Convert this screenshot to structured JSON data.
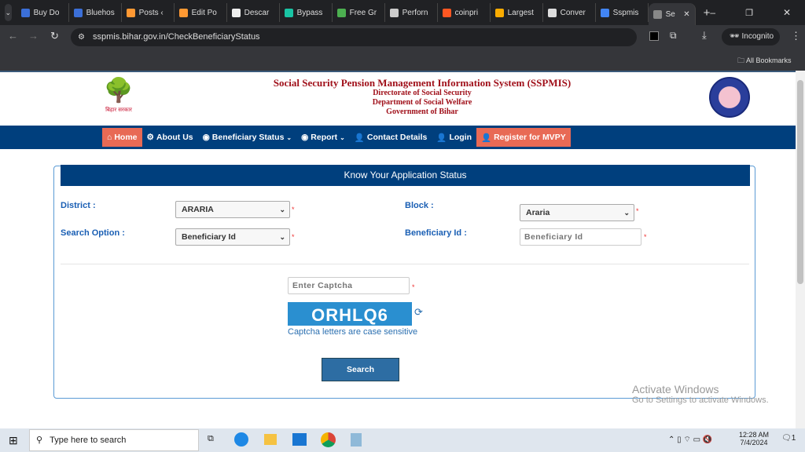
{
  "browser": {
    "tabs": [
      {
        "label": "Buy Do",
        "color": "#3b6fd8"
      },
      {
        "label": "Bluehos",
        "color": "#3b6fd8"
      },
      {
        "label": "Posts ‹",
        "color": "#ff9933"
      },
      {
        "label": "Edit Po",
        "color": "#ff9933"
      },
      {
        "label": "Descar",
        "color": "#eee"
      },
      {
        "label": "Bypass",
        "color": "#19c4a4"
      },
      {
        "label": "Free Gr",
        "color": "#4caf50"
      },
      {
        "label": "Perforn",
        "color": "#ccc"
      },
      {
        "label": "coinpri",
        "color": "#ff5722"
      },
      {
        "label": "Largest",
        "color": "#f9ab00"
      },
      {
        "label": "Conver",
        "color": "#ddd"
      },
      {
        "label": "Sspmis",
        "color": "#4285f4"
      },
      {
        "label": "Se",
        "color": "#888"
      }
    ],
    "url": "sspmis.bihar.gov.in/CheckBeneficiaryStatus",
    "incognito": "Incognito",
    "bookmarks": "All Bookmarks"
  },
  "header": {
    "title": "Social Security Pension Management Information System (SSPMIS)",
    "line2": "Directorate of Social Security",
    "line3": "Department of Social Welfare",
    "line4": "Government of Bihar",
    "logo_text": "बिहार सरकार"
  },
  "nav": [
    "Home",
    "About Us",
    "Beneficiary Status",
    "Report",
    "Contact Details",
    "Login",
    "Register for MVPY"
  ],
  "form": {
    "title": "Know Your Application Status",
    "district_label": "District   :",
    "district_value": "ARARIA",
    "block_label": "Block  :",
    "block_value": "Araria",
    "search_option_label": "Search Option  :",
    "search_option_value": "Beneficiary Id",
    "beneficiary_label": "Beneficiary Id :",
    "beneficiary_placeholder": "Beneficiary Id",
    "captcha_placeholder": "Enter Captcha",
    "captcha_code": "ORHLQ6",
    "captcha_note": "Captcha letters are case sensitive",
    "search_button": "Search"
  },
  "watermark": {
    "line1": "Activate Windows",
    "line2": "Go to Settings to activate Windows."
  },
  "taskbar": {
    "search": "Type here to search",
    "time": "12:28 AM",
    "date": "7/4/2024",
    "notif": "1"
  }
}
